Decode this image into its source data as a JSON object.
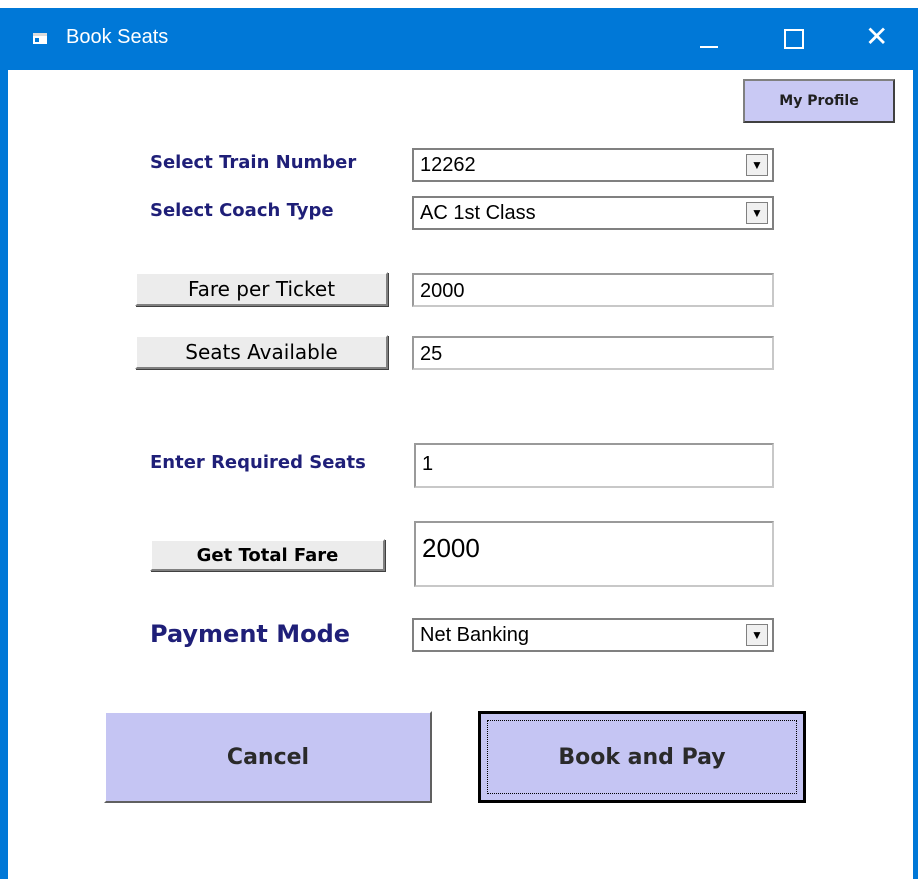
{
  "window": {
    "title": "Book Seats",
    "minimize_glyph": "",
    "close_glyph": "✕"
  },
  "header": {
    "profile_button": "My Profile"
  },
  "form": {
    "train_label": "Select Train Number",
    "train_value": "12262",
    "coach_label": "Select Coach Type",
    "coach_value": "AC 1st Class",
    "fare_button": "Fare per Ticket",
    "fare_value": "2000",
    "seats_button": "Seats Available",
    "seats_value": "25",
    "required_label": "Enter Required Seats",
    "required_value": "1",
    "total_button": "Get Total Fare",
    "total_value": "2000",
    "payment_label": "Payment Mode",
    "payment_value": "Net Banking",
    "dropdown_arrow": "▼"
  },
  "actions": {
    "cancel": "Cancel",
    "book": "Book and Pay"
  },
  "colors": {
    "titlebar": "#0078d7",
    "label_text": "#1f1f78",
    "action_button": "#c5c5f3",
    "profile_button": "#c9c9f4"
  },
  "icons": {
    "app": "window-app-icon",
    "minimize": "minimize-icon",
    "maximize": "maximize-icon",
    "close": "close-icon",
    "dropdown": "chevron-down-icon"
  }
}
